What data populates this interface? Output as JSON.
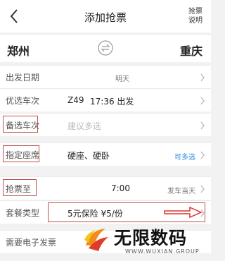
{
  "header": {
    "title": "添加抢票",
    "help": "抢票\n说明"
  },
  "stations": {
    "from": "郑州",
    "to": "重庆"
  },
  "rows": [
    {
      "label": "出发日期",
      "value": "明天"
    },
    {
      "label": "优选车次",
      "train": "Z49",
      "time": "17:36 出发"
    },
    {
      "label": "备选车次",
      "value": "建议多选"
    },
    {
      "label": "指定座席",
      "value": "硬座、硬卧",
      "extra": "可多选"
    },
    {
      "label": "抢票至",
      "value": "7:00",
      "extra": "发车当天"
    },
    {
      "label": "套餐类型",
      "value": "5元保险 ¥5/份"
    },
    {
      "label": "需要电子发票"
    }
  ],
  "logo": {
    "name": "无限数码",
    "sub": "WWW.WUXIAN.GROUP"
  },
  "colors": {
    "highlight_box": "#c0504d",
    "link_blue": "#2f8ae0",
    "arrow": "#e03030"
  }
}
